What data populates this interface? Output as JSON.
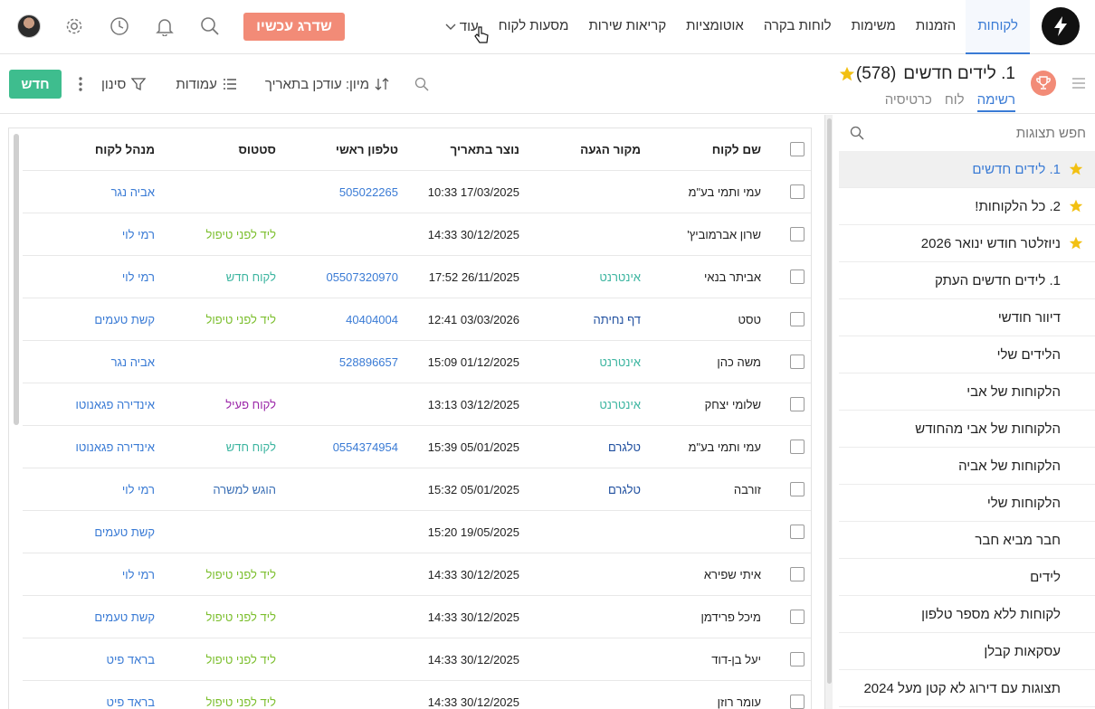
{
  "nav": {
    "items": [
      "לקוחות",
      "הזמנות",
      "משימות",
      "לוחות בקרה",
      "אוטומציות",
      "קריאות שירות",
      "מסעות לקוח"
    ],
    "more_label": "עוד",
    "upgrade_label": "שדרג עכשיו"
  },
  "header": {
    "title": "1. לידים חדשים",
    "count": "(578)",
    "tabs": [
      "רשימה",
      "לוח",
      "כרטיסיה"
    ],
    "toolbar": {
      "new_label": "חדש",
      "filter_label": "סינון",
      "columns_label": "עמודות",
      "sort_label": "מיון: עודכן בתאריך"
    }
  },
  "sidebar": {
    "search_placeholder": "חפש תצוגות",
    "items": [
      {
        "label": "1. לידים חדשים",
        "starred": true,
        "active": true
      },
      {
        "label": "2. כל הלקוחות!",
        "starred": true,
        "active": false
      },
      {
        "label": "ניוזלטר חודש ינואר 2026",
        "starred": true,
        "active": false
      },
      {
        "label": "1. לידים חדשים העתק",
        "starred": false,
        "active": false
      },
      {
        "label": "דיוור חודשי",
        "starred": false,
        "active": false
      },
      {
        "label": "הלידים שלי",
        "starred": false,
        "active": false
      },
      {
        "label": "הלקוחות של אבי",
        "starred": false,
        "active": false
      },
      {
        "label": "הלקוחות של אבי מהחודש",
        "starred": false,
        "active": false
      },
      {
        "label": "הלקוחות של אביה",
        "starred": false,
        "active": false
      },
      {
        "label": "הלקוחות שלי",
        "starred": false,
        "active": false
      },
      {
        "label": "חבר מביא חבר",
        "starred": false,
        "active": false
      },
      {
        "label": "לידים",
        "starred": false,
        "active": false
      },
      {
        "label": "לקוחות ללא מספר טלפון",
        "starred": false,
        "active": false
      },
      {
        "label": "עסקאות קבלן",
        "starred": false,
        "active": false
      },
      {
        "label": "תצוגות עם דירוג לא קטן מעל 2024",
        "starred": false,
        "active": false
      }
    ]
  },
  "table": {
    "columns": {
      "name": "שם לקוח",
      "source": "מקור הגעה",
      "created": "נוצר בתאריך",
      "phone": "טלפון ראשי",
      "status": "סטטוס",
      "manager": "מנהל לקוח"
    },
    "rows": [
      {
        "name": "עמי ותמי בע\"מ",
        "source": "",
        "created": "17/03/2025 10:33",
        "phone": "505022265",
        "status": "",
        "manager": "אביה נגר"
      },
      {
        "name": "שרון אברמוביץ'",
        "source": "",
        "created": "30/12/2025 14:33",
        "phone": "",
        "status": "ליד לפני טיפול",
        "manager": "רמי לוי"
      },
      {
        "name": "אביתר בנאי",
        "source": "אינטרנט",
        "created": "26/11/2025 17:52",
        "phone": "05507320970",
        "status": "לקוח חדש",
        "manager": "רמי לוי"
      },
      {
        "name": "טסט",
        "source": "דף נחיתה",
        "created": "03/03/2026 12:41",
        "phone": "40404004",
        "status": "ליד לפני טיפול",
        "manager": "קשת טעמים"
      },
      {
        "name": "משה כהן",
        "source": "אינטרנט",
        "created": "01/12/2025 15:09",
        "phone": "528896657",
        "status": "",
        "manager": "אביה נגר"
      },
      {
        "name": "שלומי יצחק",
        "source": "אינטרנט",
        "created": "03/12/2025 13:13",
        "phone": "",
        "status": "לקוח פעיל",
        "manager": "אינדירה פגאנוטו"
      },
      {
        "name": "עמי ותמי בע\"מ",
        "source": "טלגרם",
        "created": "05/01/2025 15:39",
        "phone": "0554374954",
        "status": "לקוח חדש",
        "manager": "אינדירה פגאנוטו"
      },
      {
        "name": "זורבה",
        "source": "טלגרם",
        "created": "05/01/2025 15:32",
        "phone": "",
        "status": "הוגש למשרה",
        "manager": "רמי לוי"
      },
      {
        "name": "",
        "source": "",
        "created": "19/05/2025 15:20",
        "phone": "",
        "status": "",
        "manager": "קשת טעמים"
      },
      {
        "name": "איתי שפירא",
        "source": "",
        "created": "30/12/2025 14:33",
        "phone": "",
        "status": "ליד לפני טיפול",
        "manager": "רמי לוי"
      },
      {
        "name": "מיכל פרידמן",
        "source": "",
        "created": "30/12/2025 14:33",
        "phone": "",
        "status": "ליד לפני טיפול",
        "manager": "קשת טעמים"
      },
      {
        "name": "יעל בן-דוד",
        "source": "",
        "created": "30/12/2025 14:33",
        "phone": "",
        "status": "ליד לפני טיפול",
        "manager": "בראד פיט"
      },
      {
        "name": "עומר רוזן",
        "source": "",
        "created": "30/12/2025 14:33",
        "phone": "",
        "status": "ליד לפני טיפול",
        "manager": "בראד פיט"
      }
    ]
  },
  "colors": {
    "accent": "#3a7bd5",
    "upgrade": "#f28b77",
    "new_button": "#3ebd8e",
    "star": "#f2c012",
    "status_prelead": "#7cbf2e",
    "status_new": "#3cb5a0",
    "status_active": "#9b27a8"
  }
}
